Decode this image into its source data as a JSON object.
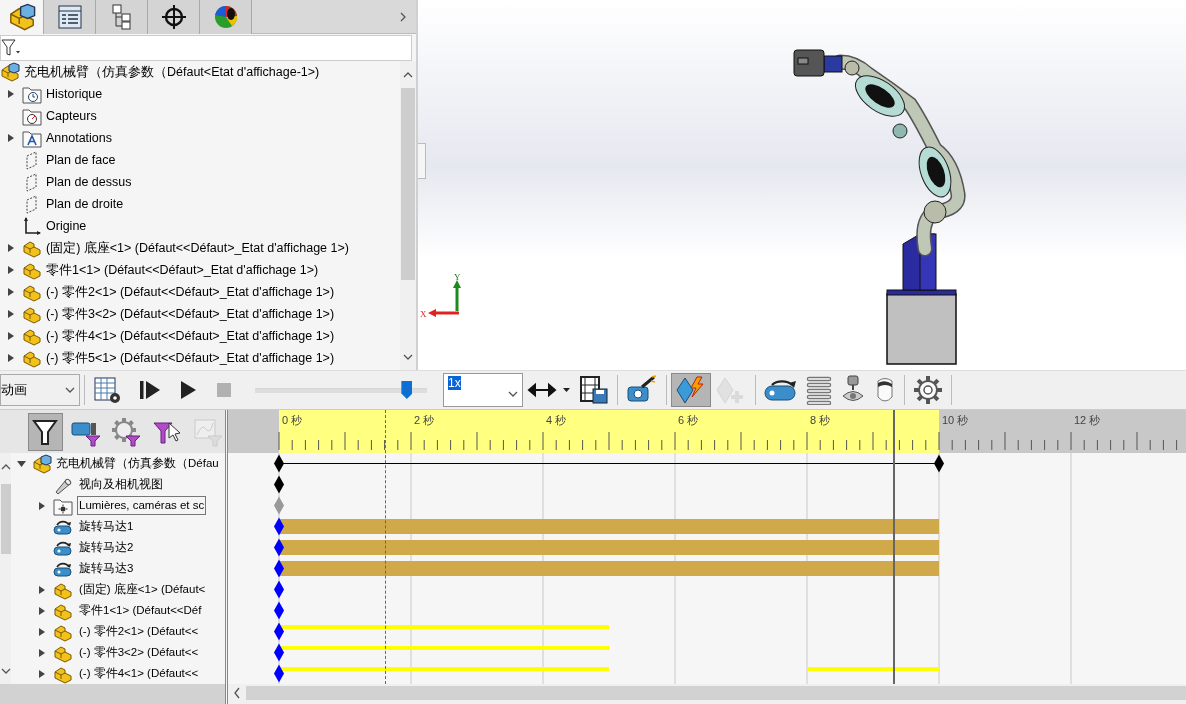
{
  "feature_tree": {
    "tabs": [
      {
        "kind": "assembly",
        "selected": true
      },
      {
        "kind": "properties",
        "selected": false
      },
      {
        "kind": "configurations",
        "selected": false
      },
      {
        "kind": "target",
        "selected": false
      },
      {
        "kind": "appearance",
        "selected": false
      }
    ],
    "root": {
      "label": "充电机械臂（仿真参数（Défaut<Etat d'affichage-1>)"
    },
    "items": [
      {
        "label": "Historique",
        "kind": "history",
        "expandable": true
      },
      {
        "label": "Capteurs",
        "kind": "sensors",
        "expandable": false
      },
      {
        "label": "Annotations",
        "kind": "annotations",
        "expandable": true
      },
      {
        "label": "Plan de face",
        "kind": "plane",
        "expandable": false
      },
      {
        "label": "Plan de dessus",
        "kind": "plane",
        "expandable": false
      },
      {
        "label": "Plan de droite",
        "kind": "plane",
        "expandable": false
      },
      {
        "label": "Origine",
        "kind": "origin",
        "expandable": false
      },
      {
        "label": "(固定) 底座<1> (Défaut<<Défaut>_Etat d'affichage 1>)",
        "kind": "part",
        "expandable": true
      },
      {
        "label": "零件1<1> (Défaut<<Défaut>_Etat d'affichage 1>)",
        "kind": "part",
        "expandable": true
      },
      {
        "label": "(-) 零件2<1> (Défaut<<Défaut>_Etat d'affichage 1>)",
        "kind": "part",
        "expandable": true
      },
      {
        "label": "(-) 零件3<2> (Défaut<<Défaut>_Etat d'affichage 1>)",
        "kind": "part",
        "expandable": true
      },
      {
        "label": "(-) 零件4<1> (Défaut<<Défaut>_Etat d'affichage 1>)",
        "kind": "part",
        "expandable": true
      },
      {
        "label": "(-) 零件5<1> (Défaut<<Défaut>_Etat d'affichage 1>)",
        "kind": "part",
        "expandable": true
      }
    ]
  },
  "viewport": {
    "triad": {
      "x_label": "X",
      "y_label": "Y"
    }
  },
  "motion_toolbar": {
    "study_type": "动画",
    "slider": {
      "level": 0.88
    },
    "speed": "1x",
    "buttons": [
      {
        "kind": "calculate",
        "active": false,
        "disabled": false
      },
      {
        "kind": "play_from_start",
        "active": false,
        "disabled": false
      },
      {
        "kind": "play",
        "active": false,
        "disabled": false
      },
      {
        "kind": "stop",
        "active": false,
        "disabled": true
      }
    ],
    "tools": [
      {
        "kind": "playback_mode",
        "active": false,
        "disabled": false
      },
      {
        "kind": "save_animation",
        "active": false,
        "disabled": false
      },
      {
        "kind": "animation_wizard",
        "active": false,
        "disabled": false
      },
      {
        "kind": "autokey",
        "active": true,
        "disabled": false
      },
      {
        "kind": "add_key",
        "active": false,
        "disabled": true
      },
      {
        "kind": "motor",
        "active": false,
        "disabled": false
      },
      {
        "kind": "spring",
        "active": false,
        "disabled": false
      },
      {
        "kind": "contact",
        "active": false,
        "disabled": false
      },
      {
        "kind": "gravity",
        "active": false,
        "disabled": false
      },
      {
        "kind": "options",
        "active": false,
        "disabled": false
      }
    ]
  },
  "motion_tree": {
    "filters": [
      {
        "kind": "filter",
        "selected": true,
        "disabled": false
      },
      {
        "kind": "camera_filter",
        "selected": false,
        "disabled": false
      },
      {
        "kind": "gear_filter",
        "selected": false,
        "disabled": false
      },
      {
        "kind": "cursor_filter",
        "selected": false,
        "disabled": false
      },
      {
        "kind": "chart_filter",
        "selected": false,
        "disabled": true
      }
    ],
    "root": {
      "label": "充电机械臂（仿真参数（Défau",
      "expanded": true
    },
    "items": [
      {
        "label": "视向及相机视图",
        "kind": "camera",
        "expandable": false,
        "selected": false
      },
      {
        "label": "Lumières, caméras et sc",
        "kind": "lights",
        "expandable": true,
        "selected": true
      },
      {
        "label": "旋转马达1",
        "kind": "motor",
        "expandable": false,
        "selected": false
      },
      {
        "label": "旋转马达2",
        "kind": "motor",
        "expandable": false,
        "selected": false
      },
      {
        "label": "旋转马达3",
        "kind": "motor",
        "expandable": false,
        "selected": false
      },
      {
        "label": "(固定) 底座<1> (Défaut<",
        "kind": "part",
        "expandable": true,
        "selected": false
      },
      {
        "label": "零件1<1> (Défaut<<Déf",
        "kind": "part",
        "expandable": true,
        "selected": false
      },
      {
        "label": "(-) 零件2<1> (Défaut<<",
        "kind": "part",
        "expandable": true,
        "selected": false
      },
      {
        "label": "(-) 零件3<2> (Défaut<<",
        "kind": "part",
        "expandable": true,
        "selected": false
      },
      {
        "label": "(-) 零件4<1> (Défaut<<",
        "kind": "part",
        "expandable": true,
        "selected": false
      }
    ]
  },
  "timeline": {
    "ticks": [
      "0 秒",
      "2 秒",
      "4 秒",
      "6 秒",
      "8 秒",
      "10 秒",
      "12 秒"
    ],
    "rows": [
      {
        "keys": [
          {
            "kind": "start",
            "color": "#000000"
          },
          {
            "kind": "end",
            "color": "#000000"
          }
        ],
        "segments": [
          {
            "kind": "line_full"
          }
        ]
      },
      {
        "keys": [
          {
            "kind": "start",
            "color": "#000000"
          }
        ]
      },
      {
        "keys": [
          {
            "kind": "start",
            "color": "#999999"
          }
        ]
      },
      {
        "keys": [
          {
            "kind": "start",
            "color": "#0000ff"
          }
        ],
        "segments": [
          {
            "kind": "thick_full"
          }
        ]
      },
      {
        "keys": [
          {
            "kind": "start",
            "color": "#0000ff"
          }
        ],
        "segments": [
          {
            "kind": "thick_full"
          }
        ]
      },
      {
        "keys": [
          {
            "kind": "start",
            "color": "#0000ff"
          }
        ],
        "segments": [
          {
            "kind": "thick_full"
          }
        ]
      },
      {
        "keys": [
          {
            "kind": "start",
            "color": "#0000ff"
          }
        ]
      },
      {
        "keys": [
          {
            "kind": "start",
            "color": "#0000ff"
          }
        ]
      },
      {
        "keys": [
          {
            "kind": "start",
            "color": "#0000ff"
          }
        ],
        "segments": [
          {
            "kind": "thin_first_half"
          }
        ]
      },
      {
        "keys": [
          {
            "kind": "start",
            "color": "#0000ff"
          }
        ],
        "segments": [
          {
            "kind": "thin_first_half"
          }
        ]
      },
      {
        "keys": [
          {
            "kind": "start",
            "color": "#0000ff"
          }
        ],
        "segments": [
          {
            "kind": "thin_first_half"
          },
          {
            "kind": "thin_last_fifth"
          }
        ]
      }
    ]
  }
}
